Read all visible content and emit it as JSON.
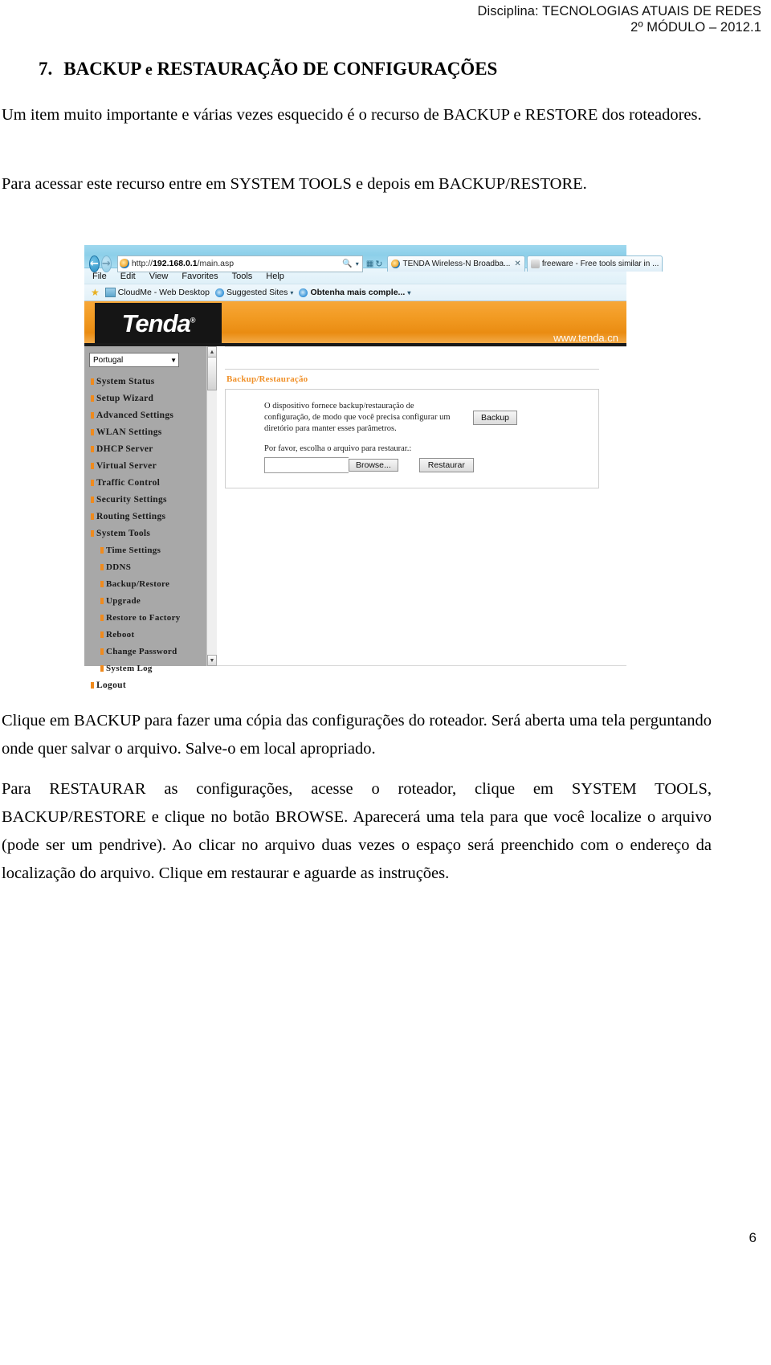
{
  "header": {
    "line1": "Disciplina: TECNOLOGIAS ATUAIS DE REDES",
    "line2": "2º MÓDULO – 2012.1"
  },
  "section": {
    "number": "7.",
    "title_upper": "BACKUP",
    "title_lower": "e",
    "title_rest": "RESTAURAÇÃO DE CONFIGURAÇÕES",
    "full_title": "7.  BACKUP e RESTAURAÇÃO DE CONFIGURAÇÕES"
  },
  "paragraphs": {
    "p1": "Um item muito importante e várias vezes esquecido é o recurso de BACKUP e RESTORE dos roteadores.",
    "p2": "Para acessar este recurso entre em SYSTEM TOOLS e depois em BACKUP/RESTORE.",
    "p3": "Clique em BACKUP para fazer uma cópia das configurações do roteador. Será aberta uma tela perguntando onde quer salvar o arquivo. Salve-o em local apropriado.",
    "p4": "Para RESTAURAR as configurações, acesse o roteador, clique em SYSTEM TOOLS, BACKUP/RESTORE e clique no botão BROWSE. Aparecerá uma tela para que você localize o arquivo (pode ser um pendrive). Ao clicar no arquivo duas vezes o espaço será preenchido com o endereço da localização do arquivo. Clique em restaurar e aguarde as instruções."
  },
  "screenshot": {
    "browser": {
      "url": "http://192.168.0.1/main.asp",
      "url_host": "192.168.0.1",
      "url_scheme": "http://",
      "url_path": "/main.asp",
      "nav_back": "←",
      "nav_forward": "→",
      "search_icon": "search-icon",
      "compat_icon": "compatibility-icon",
      "refresh_icon": "refresh-icon",
      "tabs": [
        {
          "label": "TENDA Wireless-N Broadba...",
          "close": "✕",
          "active": true
        },
        {
          "label": "freeware - Free tools similar in ...",
          "close": "",
          "active": false
        }
      ],
      "menu": [
        "File",
        "Edit",
        "View",
        "Favorites",
        "Tools",
        "Help"
      ],
      "favorites": [
        {
          "label": "CloudMe - Web Desktop",
          "icon": "cloud-icon",
          "caret": false,
          "bold": false
        },
        {
          "label": "Suggested Sites",
          "icon": "ie-icon",
          "caret": true,
          "bold": false
        },
        {
          "label": "Obtenha mais comple...",
          "icon": "ie-icon",
          "caret": true,
          "bold": true
        }
      ]
    },
    "banner": {
      "brand": "Tenda",
      "registered": "®",
      "site": "www.tenda.cn"
    },
    "sidebar": {
      "language": "Portugal",
      "language_arrow": "⌄",
      "items": [
        {
          "label": "System Status",
          "sub": false
        },
        {
          "label": "Setup Wizard",
          "sub": false
        },
        {
          "label": "Advanced Settings",
          "sub": false
        },
        {
          "label": "WLAN Settings",
          "sub": false
        },
        {
          "label": "DHCP Server",
          "sub": false
        },
        {
          "label": "Virtual Server",
          "sub": false
        },
        {
          "label": "Traffic Control",
          "sub": false
        },
        {
          "label": "Security Settings",
          "sub": false
        },
        {
          "label": "Routing Settings",
          "sub": false
        },
        {
          "label": "System Tools",
          "sub": false
        },
        {
          "label": "Time Settings",
          "sub": true
        },
        {
          "label": "DDNS",
          "sub": true
        },
        {
          "label": "Backup/Restore",
          "sub": true
        },
        {
          "label": "Upgrade",
          "sub": true
        },
        {
          "label": "Restore to Factory",
          "sub": true
        },
        {
          "label": "Reboot",
          "sub": true
        },
        {
          "label": "Change Password",
          "sub": true
        },
        {
          "label": "System Log",
          "sub": true
        },
        {
          "label": "Logout",
          "sub": false
        }
      ],
      "scroll_up": "▲",
      "scroll_down": "▼"
    },
    "panel": {
      "title": "Backup/Restauração",
      "description": "O dispositivo fornece backup/restauração de configuração, de modo que você precisa configurar um diretório para manter esses parâmetros.",
      "backup_button": "Backup",
      "restore_label": "Por favor, escolha o arquivo para restaurar.:",
      "file_value": "",
      "browse_button": "Browse...",
      "restore_button": "Restaurar"
    }
  },
  "page_number": "6",
  "colors": {
    "tenda_orange": "#f0912a",
    "banner_orange": "#ea8c12",
    "sidebar_gray": "#a8a8a8",
    "ie_blue": "#8ccfe9"
  }
}
